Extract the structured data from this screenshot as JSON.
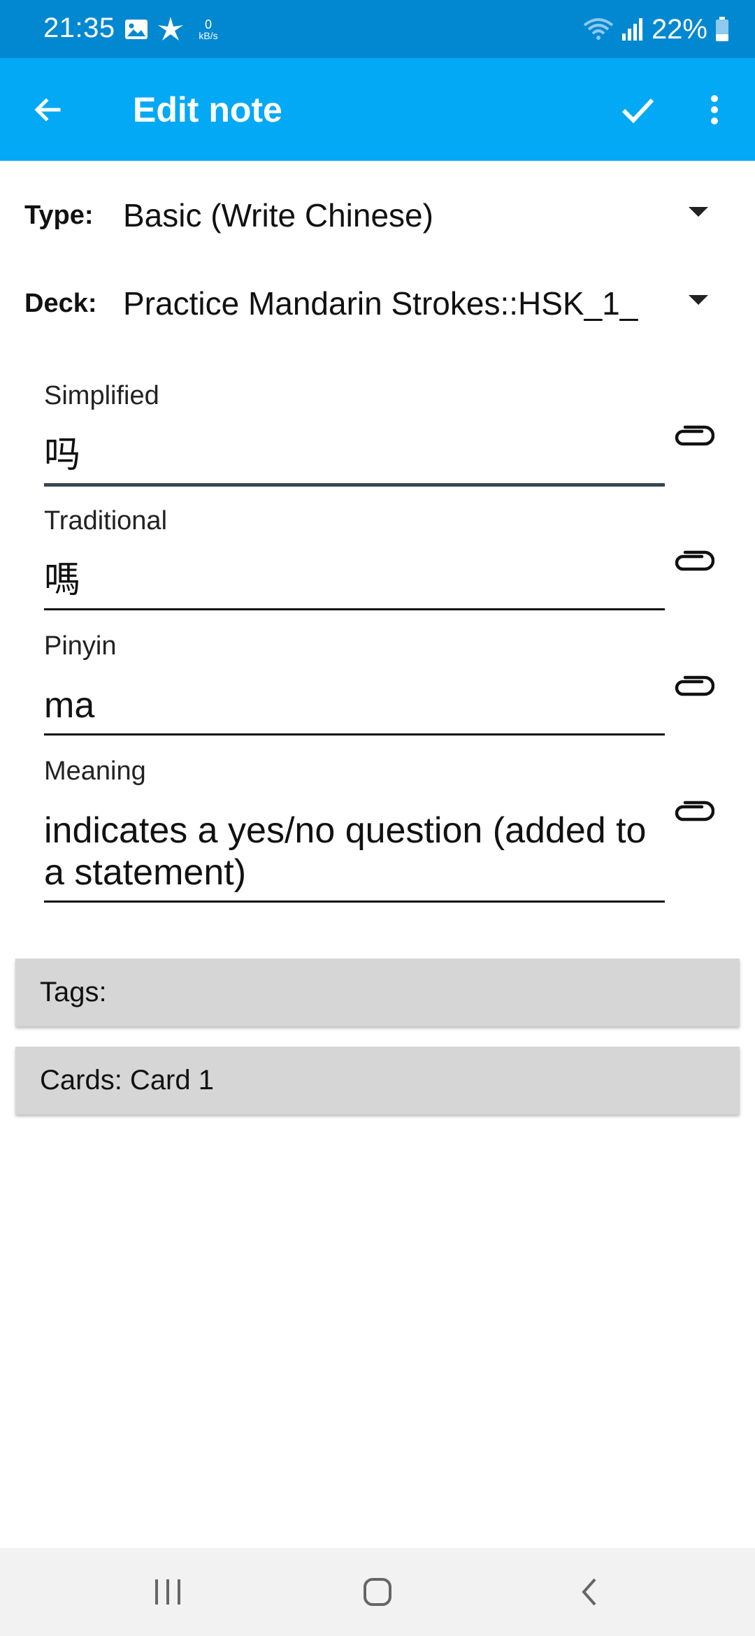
{
  "status_bar": {
    "time": "21:35",
    "speed_value": "0",
    "speed_unit": "kB/s",
    "battery": "22%",
    "icons": [
      "gallery-icon",
      "pinwheel-icon",
      "wifi-icon",
      "signal-icon",
      "battery-icon"
    ]
  },
  "app_bar": {
    "title": "Edit note",
    "icons": [
      "back-arrow-icon",
      "check-icon",
      "more-vert-icon"
    ]
  },
  "note_type": {
    "label": "Type:",
    "value": "Basic (Write Chinese)"
  },
  "deck": {
    "label": "Deck:",
    "value": "Practice Mandarin Strokes::HSK_1_.."
  },
  "fields": [
    {
      "label": "Simplified",
      "value": "吗"
    },
    {
      "label": "Traditional",
      "value": "嗎"
    },
    {
      "label": "Pinyin",
      "value": "ma"
    },
    {
      "label": "Meaning",
      "value": "indicates a yes/no question (added to a statement)"
    }
  ],
  "tags": {
    "label": "Tags:"
  },
  "cards": {
    "label": "Cards: Card 1"
  },
  "colors": {
    "status_bar": "#0288d1",
    "app_bar": "#03a9f4",
    "bar_background": "#d6d6d6"
  }
}
